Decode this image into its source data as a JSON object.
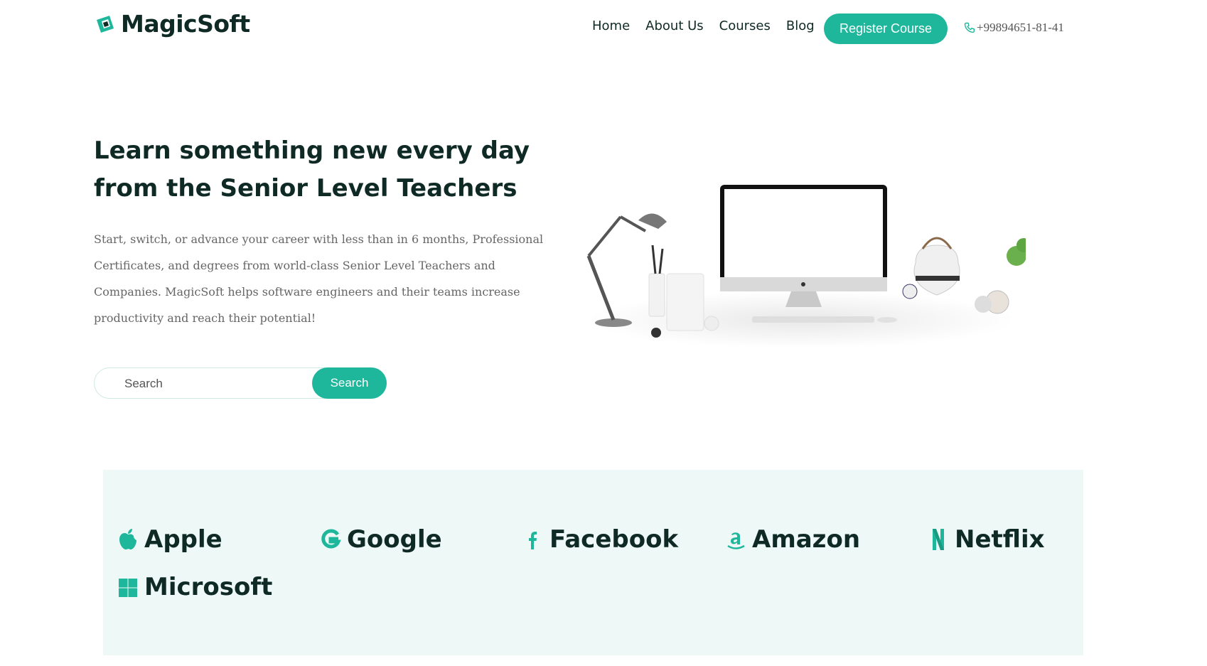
{
  "brand": {
    "name": "MagicSoft",
    "accent": "#1fb79b",
    "dark": "#0f2a25",
    "panel_bg": "#eef9f7"
  },
  "nav": {
    "items": [
      "Home",
      "About Us",
      "Courses",
      "Blog"
    ],
    "register_label": "Register Course",
    "phone": "+99894651-81-41"
  },
  "hero": {
    "title": "Learn something new every day from the Senior Level Teachers",
    "description": "Start, switch, or advance your career with less than in 6 months, Professional Certificates, and degrees from world-class Senior Level Teachers and Companies. MagicSoft helps software engineers and their teams increase productivity and reach their potential!",
    "search_placeholder": "Search",
    "search_button": "Search"
  },
  "partners": [
    {
      "name": "Apple",
      "icon": "apple-icon"
    },
    {
      "name": "Google",
      "icon": "google-icon"
    },
    {
      "name": "Facebook",
      "icon": "facebook-icon"
    },
    {
      "name": "Amazon",
      "icon": "amazon-icon"
    },
    {
      "name": "Netflix",
      "icon": "netflix-icon"
    },
    {
      "name": "Microsoft",
      "icon": "microsoft-icon"
    }
  ]
}
